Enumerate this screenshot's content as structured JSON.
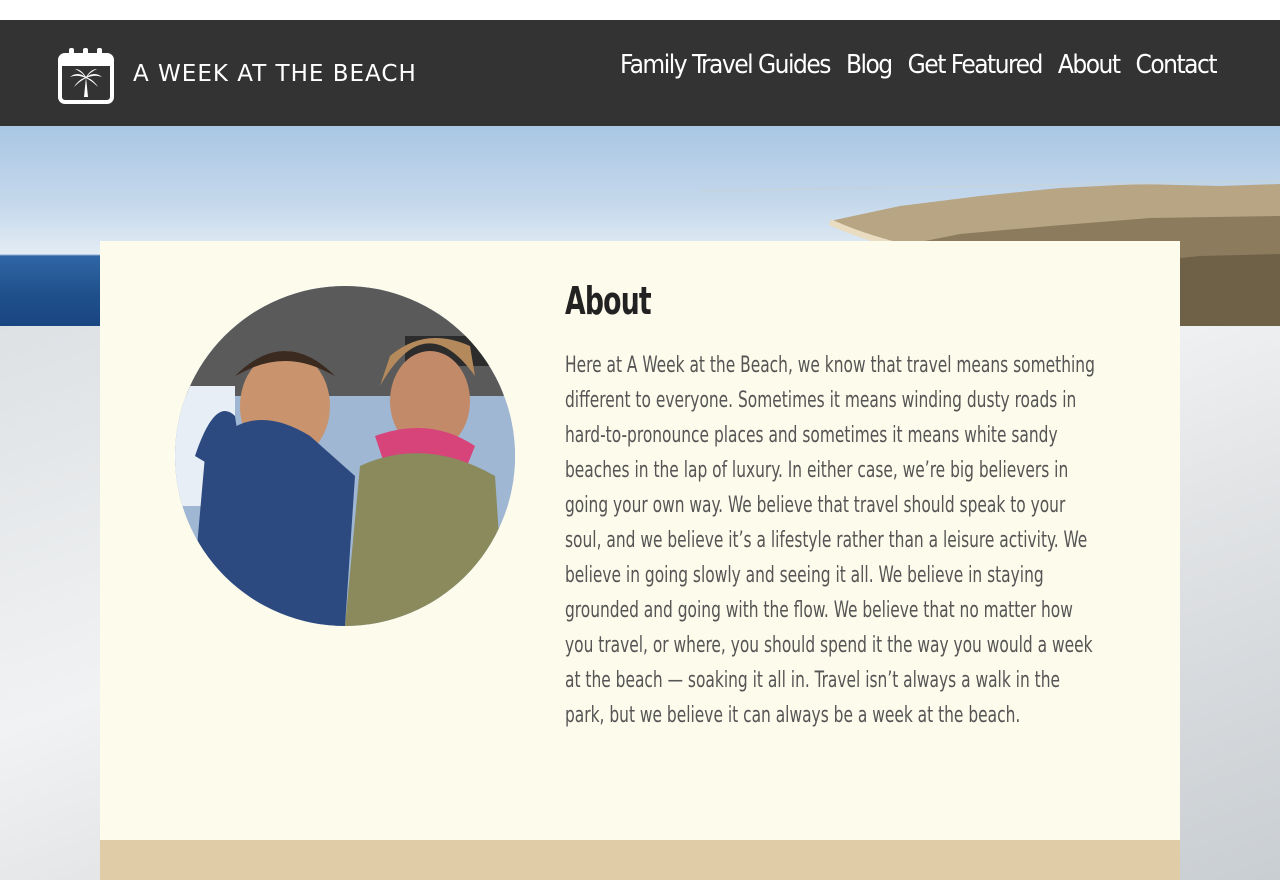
{
  "site": {
    "title": "A WEEK AT THE BEACH",
    "logo_icon": "calendar-palm-icon"
  },
  "nav": {
    "items": [
      {
        "label": "Family Travel Guides"
      },
      {
        "label": "Blog"
      },
      {
        "label": "Get Featured"
      },
      {
        "label": "About"
      },
      {
        "label": "Contact"
      }
    ]
  },
  "about": {
    "heading": "About",
    "body": "Here at A Week at the Beach, we know that travel means something different to everyone. Sometimes it means winding dusty roads in hard-to-pronounce places and sometimes it means white sandy beaches in the lap of luxury. In either case, we’re big believers in going your own way. We believe that travel should speak to your soul, and we believe it’s a lifestyle rather than a leisure activity. We believe in going slowly and seeing it all. We believe in staying grounded and going with the flow. We believe that no matter how you travel, or where, you should spend it the way you would a week at the beach — soaking it all in. Travel isn’t always a walk in the park, but we believe it can always be a week at the beach."
  },
  "colors": {
    "header_bg": "#333333",
    "card_bg": "#fdfbeb",
    "footer_band": "#e0cca6",
    "heading_text": "#222222",
    "body_text": "#555555"
  }
}
